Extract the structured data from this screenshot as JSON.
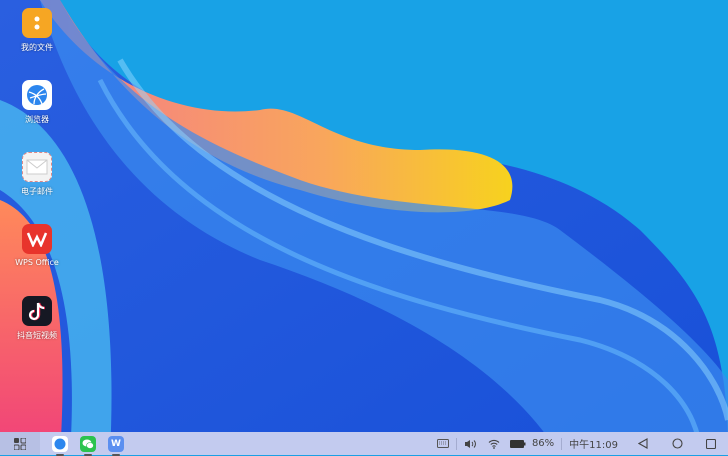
{
  "desktop": {
    "icons": [
      {
        "label": "我的文件",
        "icon": "folder-icon"
      },
      {
        "label": "浏览器",
        "icon": "browser-icon"
      },
      {
        "label": "电子邮件",
        "icon": "email-icon"
      },
      {
        "label": "WPS Office",
        "icon": "wps-icon"
      },
      {
        "label": "抖音短视频",
        "icon": "douyin-icon"
      }
    ]
  },
  "taskbar": {
    "apps": [
      {
        "name": "browser",
        "color": "#ffffff"
      },
      {
        "name": "wechat",
        "color": "#2bc34e"
      },
      {
        "name": "wps",
        "color": "#5b8ff0",
        "glyph": "W"
      }
    ],
    "battery": "86%",
    "time": "中午11:09"
  }
}
